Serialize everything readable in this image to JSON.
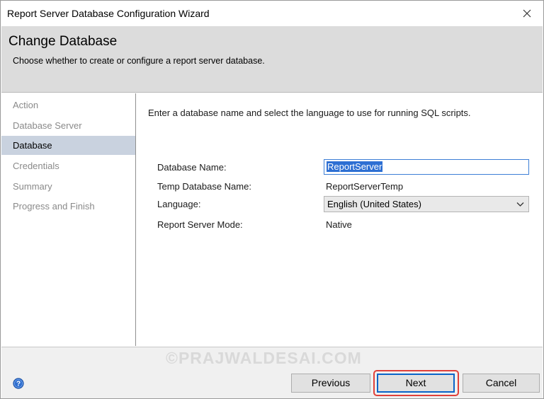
{
  "window": {
    "title": "Report Server Database Configuration Wizard"
  },
  "header": {
    "title": "Change Database",
    "subtitle": "Choose whether to create or configure a report server database."
  },
  "sidebar": {
    "items": [
      {
        "label": "Action",
        "active": false
      },
      {
        "label": "Database Server",
        "active": false
      },
      {
        "label": "Database",
        "active": true
      },
      {
        "label": "Credentials",
        "active": false
      },
      {
        "label": "Summary",
        "active": false
      },
      {
        "label": "Progress and Finish",
        "active": false
      }
    ]
  },
  "content": {
    "intro": "Enter a database name and select the language to use for running SQL scripts.",
    "fields": {
      "database_name_label": "Database Name:",
      "database_name_value": "ReportServer",
      "temp_database_name_label": "Temp Database Name:",
      "temp_database_name_value": "ReportServerTemp",
      "language_label": "Language:",
      "language_value": "English (United States)",
      "mode_label": "Report Server Mode:",
      "mode_value": "Native"
    }
  },
  "footer": {
    "watermark": "©PRAJWALDESAI.COM",
    "previous_label": "Previous",
    "next_label": "Next",
    "cancel_label": "Cancel"
  },
  "icons": {
    "close": "close-icon",
    "help": "help-icon",
    "dropdown": "chevron-down-icon"
  },
  "colors": {
    "header_bg": "#dcdcdc",
    "active_nav_bg": "#c9d2df",
    "focus_blue": "#0a64c8",
    "highlight_red": "#e0403a",
    "selection_blue": "#2d6fd3"
  }
}
